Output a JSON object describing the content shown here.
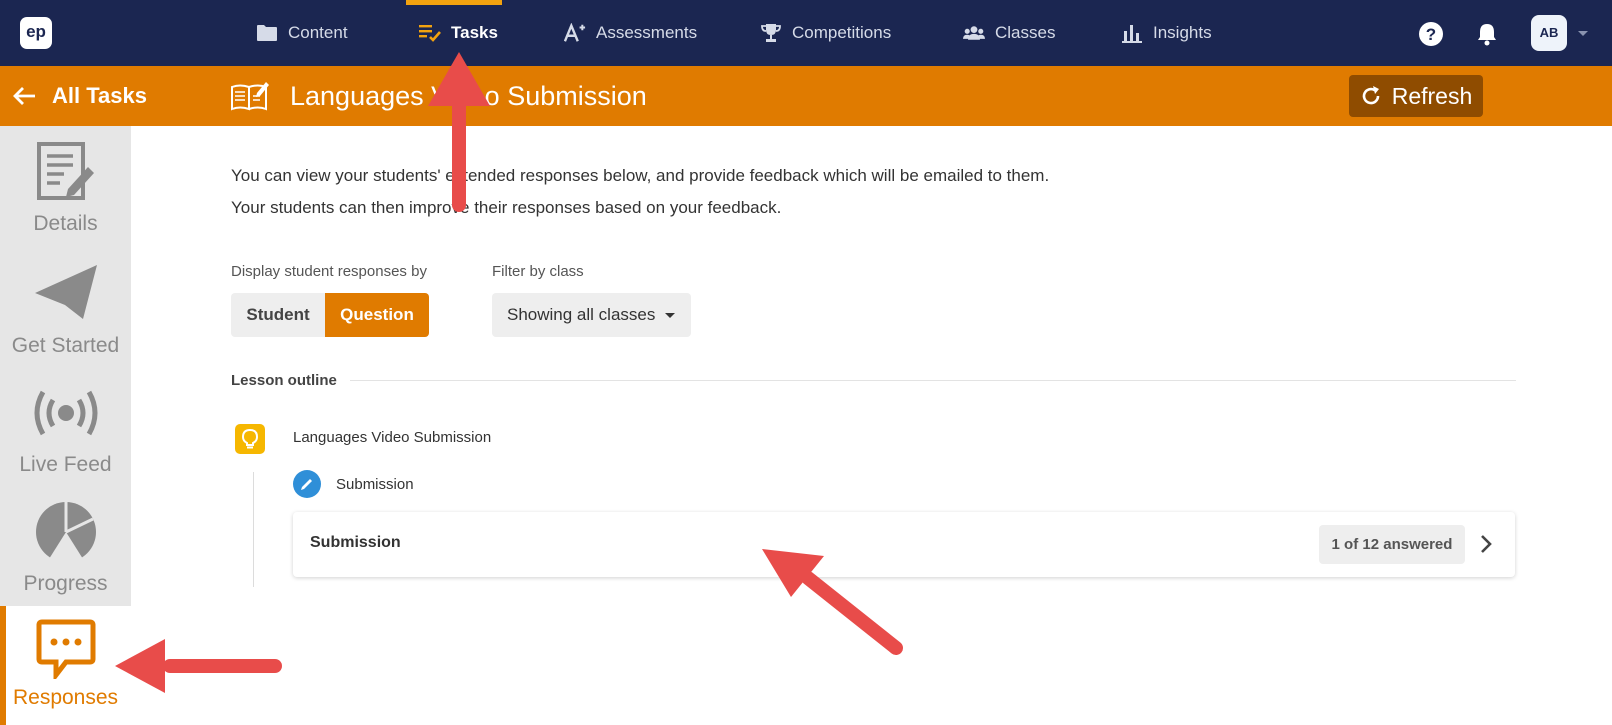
{
  "app": {
    "logo_text": "ep",
    "brand_color": "#1b2651",
    "accent_color": "#e07b00"
  },
  "topnav": {
    "items": [
      {
        "label": "Content",
        "icon": "folder-icon"
      },
      {
        "label": "Tasks",
        "icon": "tasks-icon",
        "active": true
      },
      {
        "label": "Assessments",
        "icon": "assessment-icon"
      },
      {
        "label": "Competitions",
        "icon": "trophy-icon"
      },
      {
        "label": "Classes",
        "icon": "users-icon"
      },
      {
        "label": "Insights",
        "icon": "bar-chart-icon"
      }
    ],
    "help_icon": "help-icon",
    "notification_icon": "bell-icon",
    "avatar_initials": "AB"
  },
  "subbar": {
    "back_label": "All Tasks",
    "task_title": "Languages Video Submission",
    "refresh_label": "Refresh"
  },
  "sidebar": {
    "items": [
      {
        "label": "Details",
        "icon": "document-edit-icon"
      },
      {
        "label": "Get Started",
        "icon": "paper-plane-icon"
      },
      {
        "label": "Live Feed",
        "icon": "broadcast-icon"
      },
      {
        "label": "Progress",
        "icon": "pie-chart-icon"
      },
      {
        "label": "Responses",
        "icon": "chat-bubble-icon",
        "active": true
      }
    ]
  },
  "main": {
    "intro_line1": "You can view your students' extended responses below, and provide feedback which will be emailed to them.",
    "intro_line2": "Your students can then improve their responses based on your feedback.",
    "display_label": "Display student responses by",
    "toggle_student": "Student",
    "toggle_question": "Question",
    "toggle_selected": "Question",
    "filter_label": "Filter by class",
    "filter_value": "Showing all classes",
    "outline_heading": "Lesson outline",
    "lesson_title": "Languages Video Submission",
    "sub_item_title": "Submission",
    "card_title": "Submission",
    "card_badge": "1 of 12 answered"
  }
}
